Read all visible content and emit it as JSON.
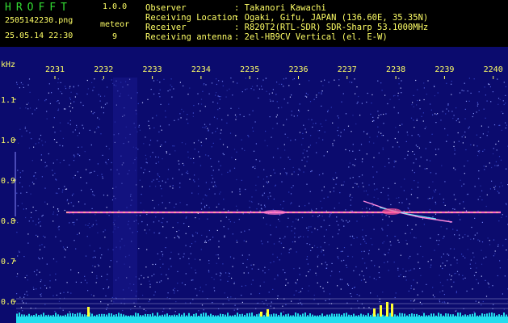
{
  "header": {
    "app_name": "HROFFT",
    "version": "1.0.0",
    "file_name": "2505142230.png",
    "datetime": "25.05.14 22:30",
    "meteor_label": "meteor",
    "meteor_count": "9",
    "info": [
      {
        "label": "Observer",
        "value": ": Takanori Kawachi"
      },
      {
        "label": "Receiving Location",
        "value": ": Ogaki, Gifu, JAPAN (136.60E, 35.35N)"
      },
      {
        "label": "Receiver",
        "value": ": R820T2(RTL-SDR) SDR-Sharp 53.1000MHz"
      },
      {
        "label": "Receiving antenna",
        "value": ": 2el-HB9CV Vertical (el. E-W)"
      }
    ]
  },
  "spectrogram": {
    "unit_label": "kHz",
    "time_ticks": [
      "2231",
      "2232",
      "2233",
      "2234",
      "2235",
      "2236",
      "2237",
      "2238",
      "2239",
      "2240"
    ],
    "freq_ticks": [
      "1.1",
      "1.0",
      "0.9",
      "0.8",
      "0.7",
      "0.6"
    ],
    "freq_range": [
      0.6,
      1.15
    ],
    "carrier_khz": 0.82,
    "colors": {
      "background": "#0b0b6e",
      "tick_label": "#ffff66",
      "bottom_bar": "#22ddee"
    }
  }
}
